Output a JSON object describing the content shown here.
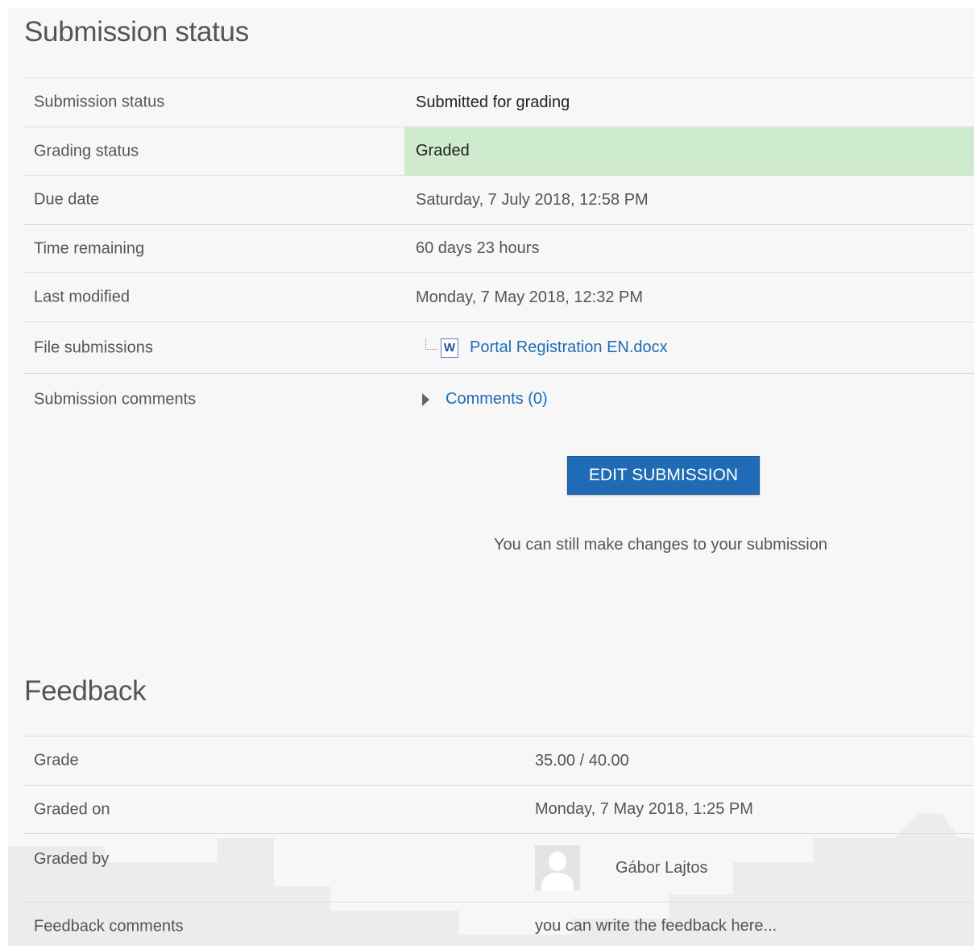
{
  "submission": {
    "heading": "Submission status",
    "rows": {
      "submission_status": {
        "label": "Submission status",
        "value": "Submitted for grading"
      },
      "grading_status": {
        "label": "Grading status",
        "value": "Graded",
        "highlight_color": "#cfebcd"
      },
      "due_date": {
        "label": "Due date",
        "value": "Saturday, 7 July 2018, 12:58 PM"
      },
      "time_remaining": {
        "label": "Time remaining",
        "value": "60 days 23 hours"
      },
      "last_modified": {
        "label": "Last modified",
        "value": "Monday, 7 May 2018, 12:32 PM"
      },
      "file_submissions": {
        "label": "File submissions",
        "file_name": "Portal Registration EN.docx",
        "file_icon": "word-doc-icon",
        "file_icon_glyph": "W"
      },
      "submission_comments": {
        "label": "Submission comments",
        "link": "Comments (0)"
      }
    },
    "edit_button": "EDIT SUBMISSION",
    "note": "You can still make changes to your submission"
  },
  "feedback": {
    "heading": "Feedback",
    "rows": {
      "grade": {
        "label": "Grade",
        "value": "35.00 / 40.00"
      },
      "graded_on": {
        "label": "Graded on",
        "value": "Monday, 7 May 2018, 1:25 PM"
      },
      "graded_by": {
        "label": "Graded by",
        "name": "Gábor Lajtos",
        "avatar_icon": "user-avatar-icon"
      },
      "feedback_comments": {
        "label": "Feedback comments",
        "value": "you can write the feedback here..."
      }
    }
  },
  "colors": {
    "accent": "#1f6bb5",
    "link": "#1f6bb5",
    "graded_highlight": "#cfebcd",
    "panel_background": "#f7f7f7"
  }
}
